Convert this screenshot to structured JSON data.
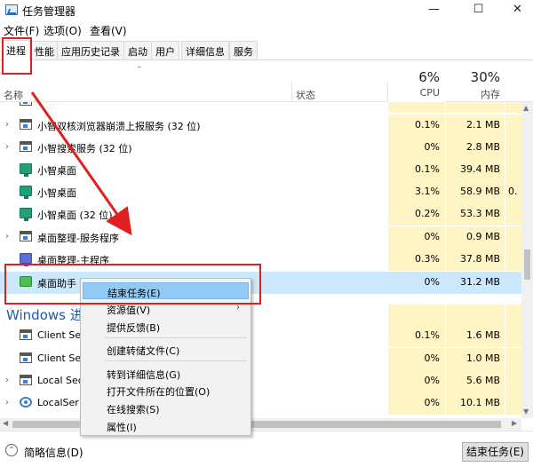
{
  "window": {
    "title": "任务管理器",
    "controls": {
      "minimize": "—",
      "maximize": "☐",
      "close": "✕"
    }
  },
  "menubar": [
    "文件(F)",
    "选项(O)",
    "查看(V)"
  ],
  "tabs": [
    "进程",
    "性能",
    "应用历史记录",
    "启动",
    "用户",
    "详细信息",
    "服务"
  ],
  "active_tab": "进程",
  "columns": {
    "name": "名称",
    "status": "状态",
    "cpu": {
      "percent": "6%",
      "label": "CPU"
    },
    "memory": {
      "percent": "30%",
      "label": "内存"
    }
  },
  "processes": [
    {
      "name": "",
      "cpu": "",
      "mem": "",
      "extra": ""
    },
    {
      "name": "小智双核浏览器崩溃上报服务 (32 位)",
      "cpu": "0.1%",
      "mem": "2.1 MB",
      "extra": ""
    },
    {
      "name": "小智搜索服务 (32 位)",
      "cpu": "0%",
      "mem": "2.8 MB",
      "extra": ""
    },
    {
      "name": "小智桌面",
      "cpu": "0.1%",
      "mem": "39.4 MB",
      "extra": ""
    },
    {
      "name": "小智桌面",
      "cpu": "3.1%",
      "mem": "58.9 MB",
      "extra": "0."
    },
    {
      "name": "小智桌面 (32 位)",
      "cpu": "0.2%",
      "mem": "53.3 MB",
      "extra": ""
    },
    {
      "name": "桌面整理-服务程序",
      "cpu": "0%",
      "mem": "0.9 MB",
      "extra": ""
    },
    {
      "name": "桌面整理-主程序",
      "cpu": "0.3%",
      "mem": "37.8 MB",
      "extra": ""
    },
    {
      "name": "桌面助手",
      "cpu": "0%",
      "mem": "31.2 MB",
      "extra": ""
    }
  ],
  "windows_group": {
    "label": "Windows 进",
    "processes": [
      {
        "name": "Client Se",
        "cpu": "0.1%",
        "mem": "1.6 MB"
      },
      {
        "name": "Client Se",
        "cpu": "0%",
        "mem": "1.0 MB"
      },
      {
        "name": "Local Sec",
        "cpu": "0%",
        "mem": "5.6 MB"
      },
      {
        "name": "LocalSer",
        "cpu": "0%",
        "mem": "10.1 MB"
      }
    ]
  },
  "context_menu": {
    "items": [
      "结束任务(E)",
      "资源值(V)",
      "提供反馈(B)",
      "创建转储文件(C)",
      "转到详细信息(G)",
      "打开文件所在的位置(O)",
      "在线搜索(S)",
      "属性(I)"
    ],
    "submenu_arrow": "›"
  },
  "footer": {
    "fewer_details": "简略信息(D)",
    "fewer_icon": "⌃",
    "end_task": "结束任务(E)"
  },
  "sort_arrow": "⌃",
  "expand_glyph": "›",
  "accent_colors": {
    "annotation_red": "#e02020",
    "selection": "#cce8ff",
    "heat": "#fff4c4",
    "menu_highlight": "#91c9f7",
    "group_text": "#1e5aa8"
  }
}
